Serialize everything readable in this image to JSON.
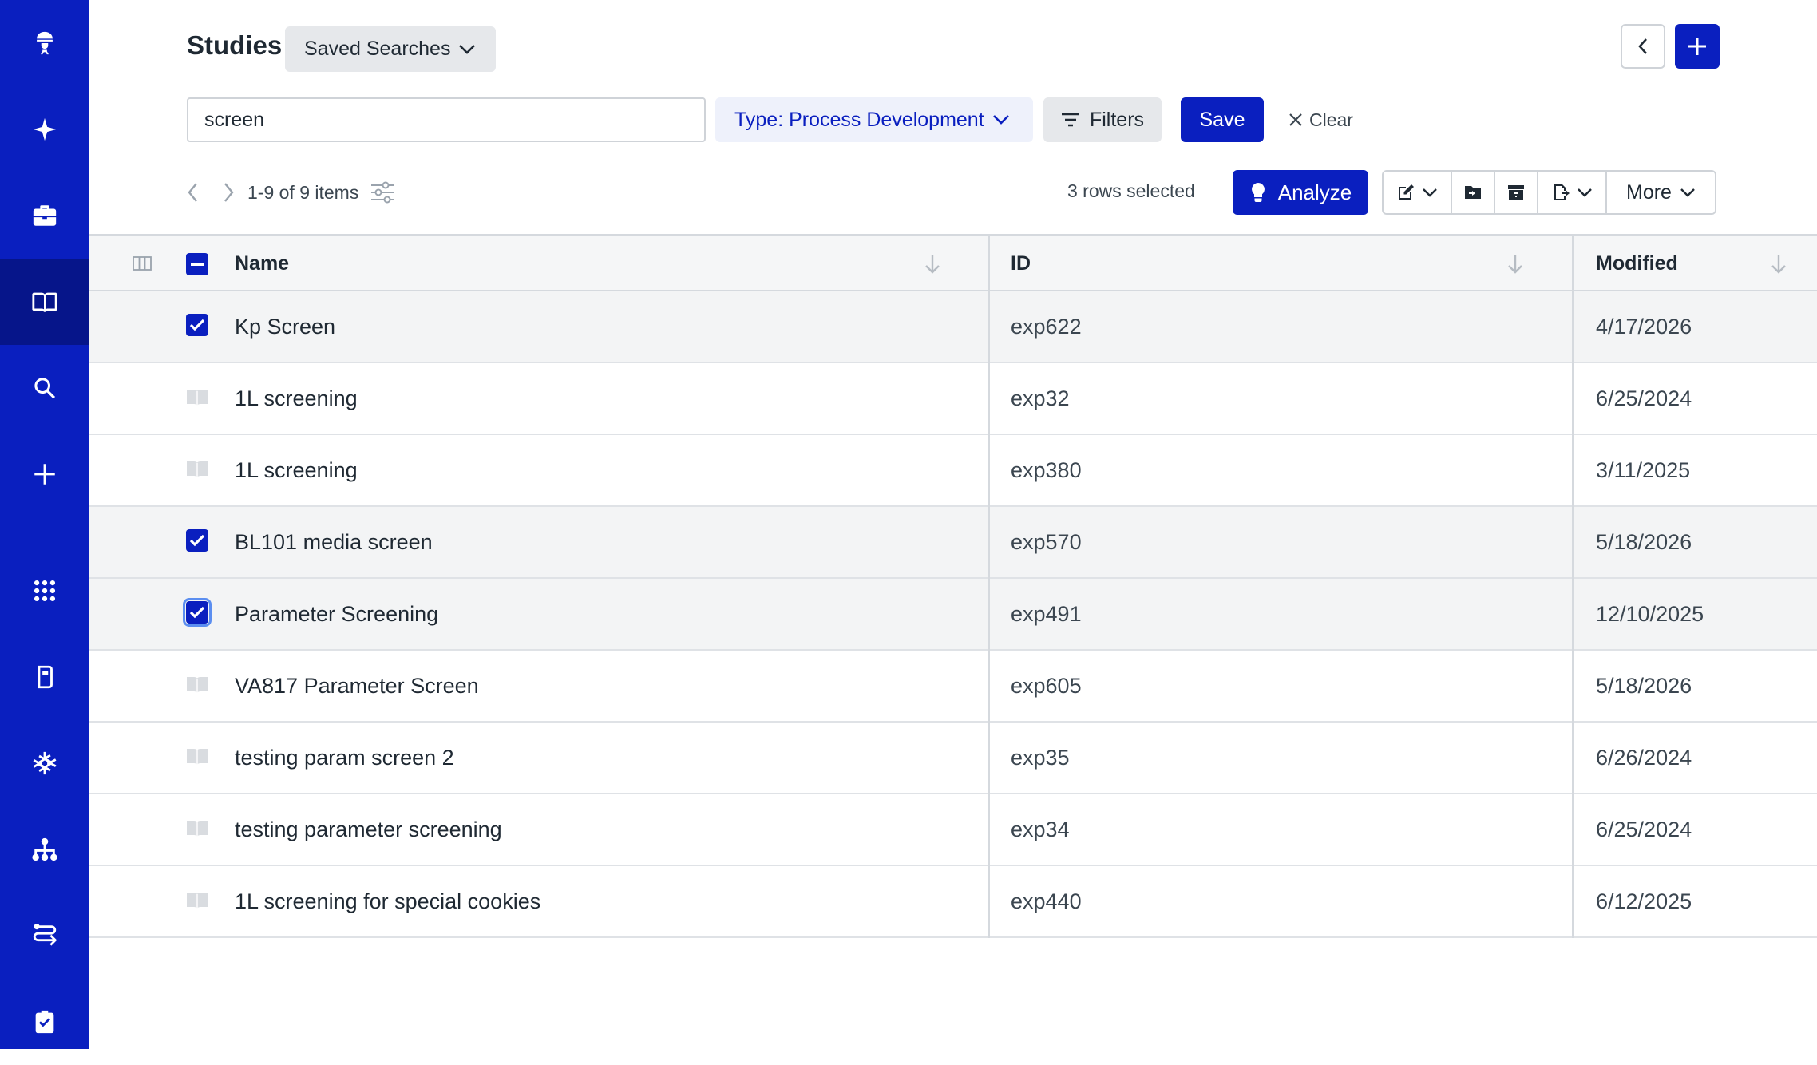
{
  "header": {
    "title": "Studies",
    "saved_searches_label": "Saved Searches"
  },
  "search": {
    "value": "screen",
    "type_filter": "Type: Process Development",
    "filters_label": "Filters",
    "save_label": "Save",
    "clear_label": "Clear"
  },
  "toolbar": {
    "pager_text": "1-9 of 9 items",
    "rows_selected": "3 rows selected",
    "analyze_label": "Analyze",
    "more_label": "More"
  },
  "table": {
    "columns": [
      "Name",
      "ID",
      "Modified"
    ],
    "rows": [
      {
        "name": "Kp Screen",
        "id": "exp622",
        "modified": "4/17/2026",
        "selected": true
      },
      {
        "name": "1L screening",
        "id": "exp32",
        "modified": "6/25/2024",
        "selected": false
      },
      {
        "name": "1L screening",
        "id": "exp380",
        "modified": "3/11/2025",
        "selected": false
      },
      {
        "name": "BL101 media screen",
        "id": "exp570",
        "modified": "5/18/2026",
        "selected": true
      },
      {
        "name": "Parameter Screening",
        "id": "exp491",
        "modified": "12/10/2025",
        "selected": true
      },
      {
        "name": "VA817 Parameter Screen",
        "id": "exp605",
        "modified": "5/18/2026",
        "selected": false
      },
      {
        "name": "testing param screen 2",
        "id": "exp35",
        "modified": "6/26/2024",
        "selected": false
      },
      {
        "name": "testing parameter screening",
        "id": "exp34",
        "modified": "6/25/2024",
        "selected": false
      },
      {
        "name": "1L screening for special cookies",
        "id": "exp440",
        "modified": "6/12/2025",
        "selected": false
      }
    ]
  },
  "sidebar": {
    "items": [
      "scientist-icon",
      "sparkle-icon",
      "briefcase-icon",
      "book-icon",
      "search-icon",
      "plus-icon",
      "apps-grid-icon",
      "notebook-icon",
      "molecule-icon",
      "hierarchy-icon",
      "workflow-icon",
      "clipboard-check-icon"
    ]
  },
  "colors": {
    "brand": "#0a1fbf",
    "brand_dark": "#06158a",
    "chip_bg": "#eef1fb"
  }
}
